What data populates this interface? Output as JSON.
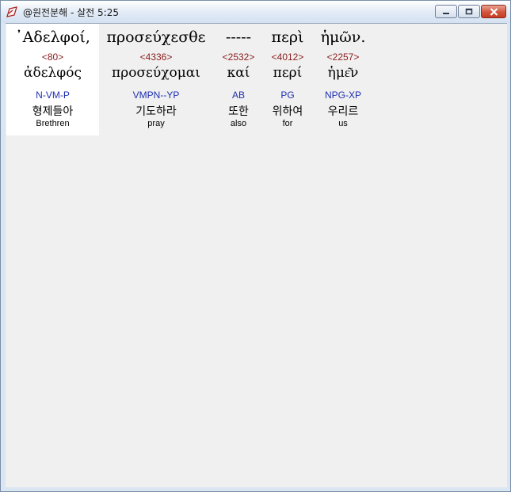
{
  "window": {
    "title": "@원전분해 - 살전 5:25"
  },
  "words": [
    {
      "greek": "᾿Αδελφοί,",
      "number": "<80>",
      "lemma": "ἀδελφός",
      "parse": "N-VM-P",
      "korean": "형제들아",
      "english": "Brethren"
    },
    {
      "greek": "προσεύχεσθε",
      "number": "<4336>",
      "lemma": "προσεύχομαι",
      "parse": "VMPN--YP",
      "korean": "기도하라",
      "english": "pray"
    },
    {
      "greek": "-----",
      "number": "<2532>",
      "lemma": "καί",
      "parse": "AB",
      "korean": "또한",
      "english": "also"
    },
    {
      "greek": "περὶ",
      "number": "<4012>",
      "lemma": "περί",
      "parse": "PG",
      "korean": "위하여",
      "english": "for"
    },
    {
      "greek": "ἡμῶν.",
      "number": "<2257>",
      "lemma": "ἡμε͂ν",
      "parse": "NPG-XP",
      "korean": "우리르",
      "english": "us"
    }
  ]
}
